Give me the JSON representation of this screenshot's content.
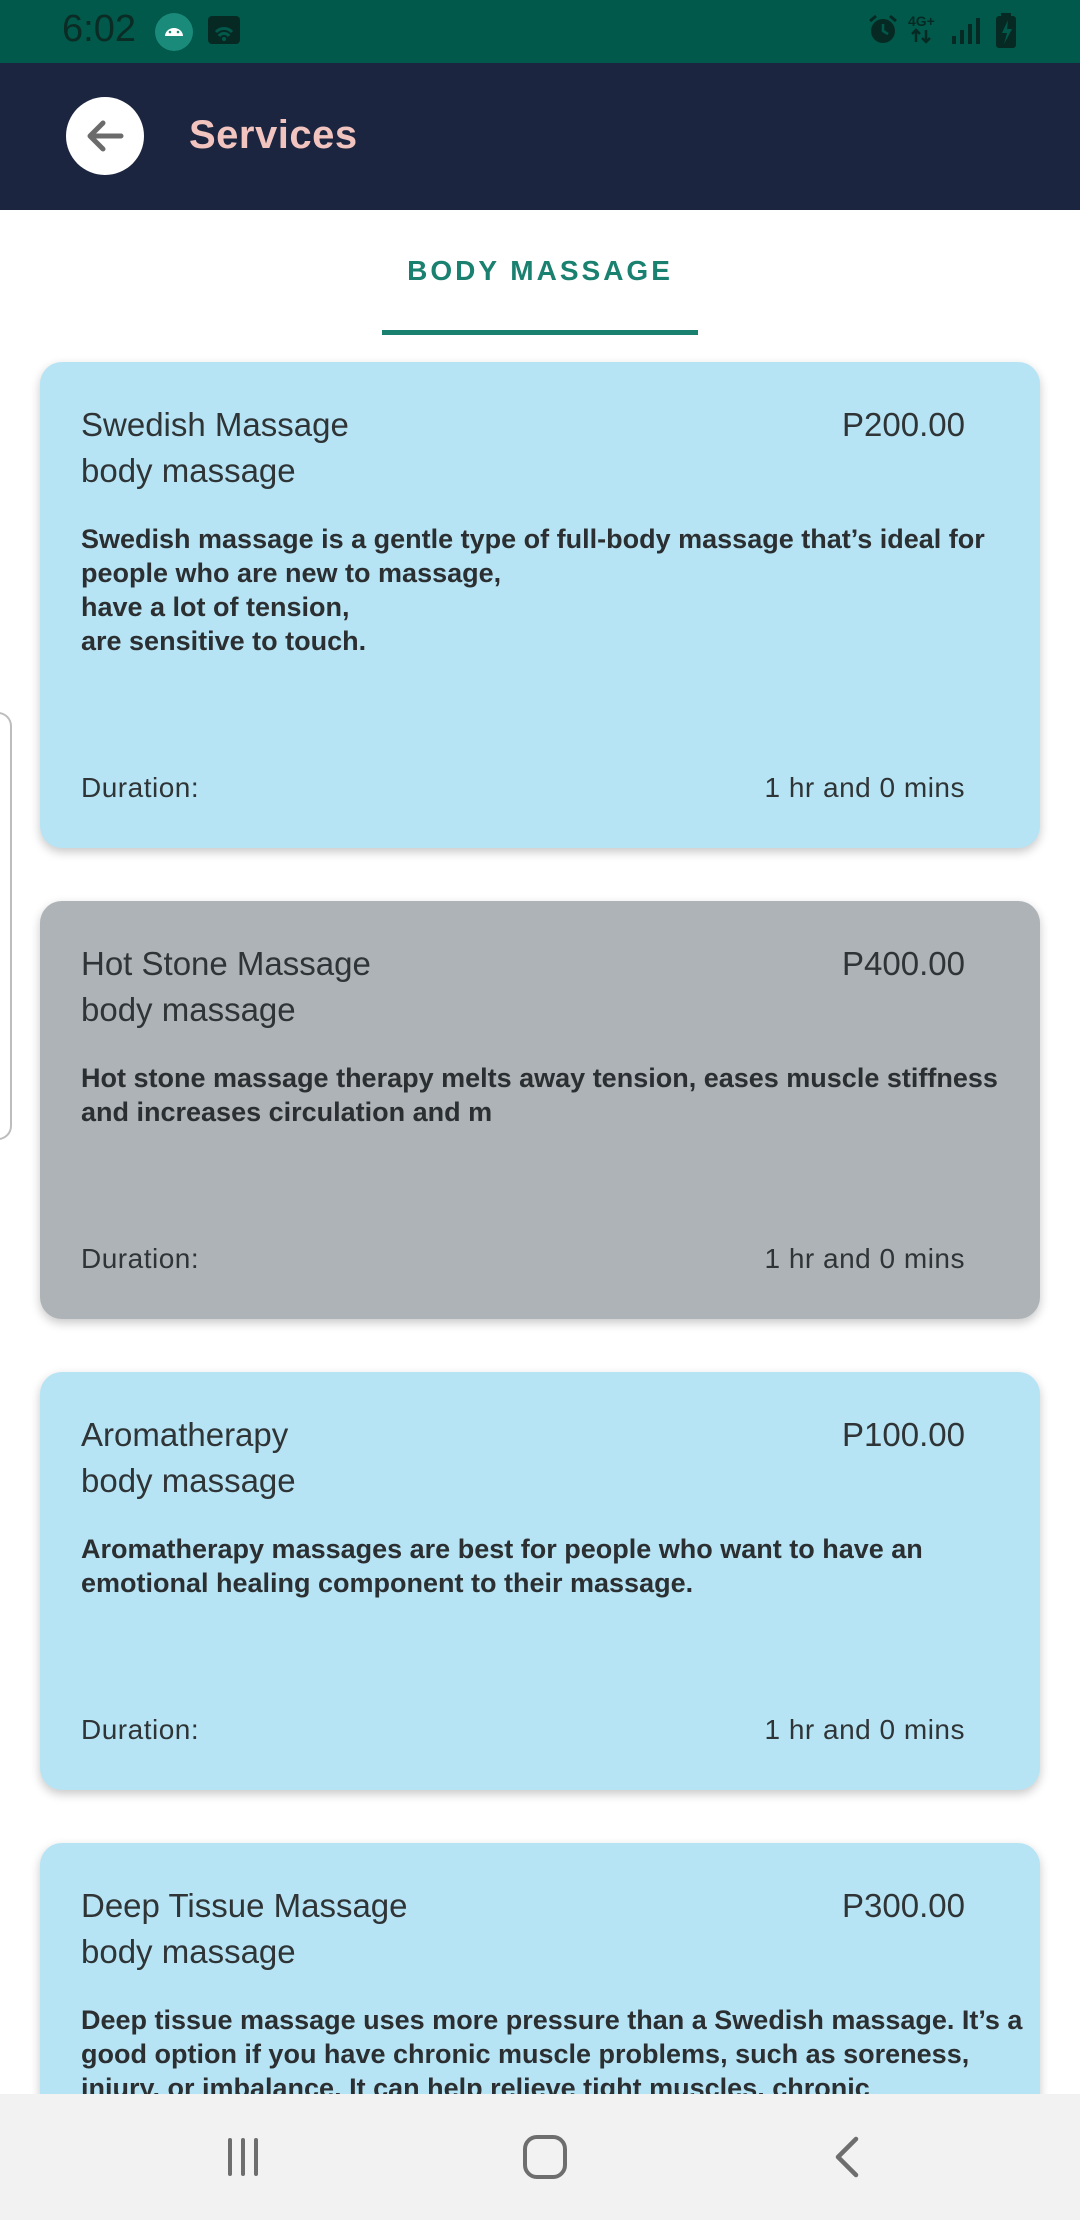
{
  "status_bar": {
    "time": "6:02",
    "network_label": "4G+",
    "icons": [
      "android-icon",
      "wifi-icon",
      "alarm-icon",
      "network-4g-icon",
      "signal-icon",
      "battery-charging-icon"
    ]
  },
  "app_bar": {
    "title": "Services",
    "back_icon": "arrow-left-icon"
  },
  "tabs": [
    {
      "label": "BODY MASSAGE",
      "selected": true
    }
  ],
  "services": [
    {
      "name": "Swedish Massage",
      "category": "body massage",
      "price": "P200.00",
      "description": "Swedish massage is a gentle type of full-body massage that’s ideal for people who are new to massage,\nhave a lot of tension,\nare sensitive to touch.",
      "duration_label": "Duration:",
      "duration_value": "1 hr and 0 mins",
      "background": "#b7e4f4"
    },
    {
      "name": "Hot Stone Massage",
      "category": "body massage",
      "price": "P400.00",
      "description": "Hot stone massage therapy melts away tension, eases muscle stiffness and increases circulation and m",
      "duration_label": "Duration:",
      "duration_value": "1 hr and 0 mins",
      "background": "#adb3b6"
    },
    {
      "name": "Aromatherapy",
      "category": "body massage",
      "price": "P100.00",
      "description": "Aromatherapy massages are best for people who want to have an emotional healing component to their massage.",
      "duration_label": "Duration:",
      "duration_value": "1 hr and 0 mins",
      "background": "#b7e4f4"
    },
    {
      "name": "Deep Tissue Massage",
      "category": "body massage",
      "price": "P300.00",
      "description": "Deep tissue massage uses more pressure than a Swedish massage. It’s a good option if you have chronic muscle problems, such as soreness, injury, or imbalance. It can help relieve tight muscles, chronic",
      "duration_label": "",
      "duration_value": "",
      "background": "#b7e4f4"
    }
  ],
  "nav_bar": {
    "icons": [
      "recent-apps-icon",
      "home-icon",
      "back-icon"
    ]
  },
  "colors": {
    "status_bar": "#00594a",
    "app_bar": "#1c2540",
    "title": "#f2c4bf",
    "tab_accent": "#1a8070",
    "card_blue": "#b7e4f4",
    "card_grey": "#adb3b6"
  }
}
